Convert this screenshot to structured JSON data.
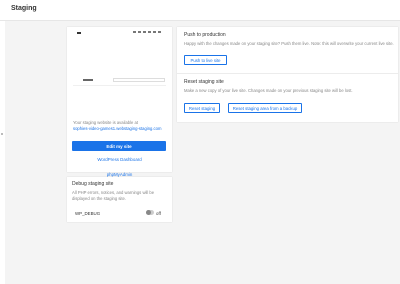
{
  "header": {
    "title": "Staging"
  },
  "staging_card": {
    "preview_site_name": "",
    "available_text": "Your staging website is available at",
    "staging_url": "sophies-video-games1.webstaging-staging.com",
    "edit_button": "Edit my site",
    "links": [
      "WordPress Dashboard",
      "phpMyAdmin",
      "SFTP"
    ]
  },
  "debug": {
    "title": "Debug staging site",
    "description": "All PHP errors, notices, and warnings will be displayed on the staging site.",
    "setting_label": "WP_DEBUG",
    "toggle_state": "off"
  },
  "push": {
    "title": "Push to production",
    "description": "Happy with the changes made on your staging site? Push them live. Note: this will overwrite your current live site.",
    "button": "Push to live site"
  },
  "reset": {
    "title": "Reset staging site",
    "description": "Make a new copy of your live site. Changes made on your previous staging site will be lost.",
    "button_reset": "Reset staging",
    "button_backup": "Reset staging area from a backup"
  },
  "colors": {
    "accent": "#1a73e8",
    "background": "#f4f4f4"
  }
}
